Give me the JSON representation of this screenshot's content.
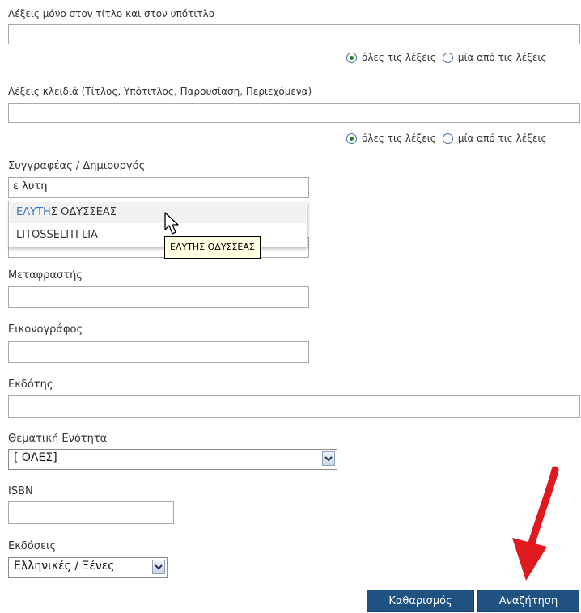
{
  "title_subtitle": {
    "label": "Λέξεις μόνο στον τίτλο και στον υπότιτλο",
    "value": "",
    "option_all": "όλες τις λέξεις",
    "option_any": "μία από τις λέξεις",
    "selected": "all"
  },
  "keywords": {
    "label": "Λέξεις κλειδιά (Τίτλος, Υπότιτλος, Παρουσίαση, Περιεχόμενα)",
    "value": "",
    "option_all": "όλες τις λέξεις",
    "option_any": "μία από τις λέξεις",
    "selected": "all"
  },
  "author": {
    "label": "Συγγραφέας / Δημιουργός",
    "value": "ε λυτη",
    "suggestions": [
      {
        "highlight": "ΕΛΥΤΗ",
        "rest": "Σ ΟΔΥΣΣΕΑΣ"
      },
      {
        "highlight": "",
        "rest": "LITOSSELITI LIA"
      }
    ],
    "tooltip": "ΕΛΥΤΗΣ ΟΔΥΣΣΕΑΣ"
  },
  "translator": {
    "label": "Μεταφραστής",
    "value": ""
  },
  "illustrator": {
    "label": "Εικονογράφος",
    "value": ""
  },
  "publisher": {
    "label": "Εκδότης",
    "value": ""
  },
  "subject": {
    "label": "Θεματική Ενότητα",
    "selected": "[ ΟΛΕΣ]"
  },
  "isbn": {
    "label": "ISBN",
    "value": ""
  },
  "editions": {
    "label": "Εκδόσεις",
    "selected": "Ελληνικές / Ξένες"
  },
  "buttons": {
    "clear": "Καθαρισμός",
    "search": "Αναζήτηση"
  },
  "colors": {
    "button_bg": "#1f5181",
    "highlight_text": "#3e77b8",
    "arrow": "#e0191f",
    "tooltip_bg": "#ffffe1"
  },
  "icons": {
    "cursor": "mouse-pointer-icon",
    "select_arrow": "chevron-down-icon",
    "annotation": "red-arrow-icon"
  }
}
